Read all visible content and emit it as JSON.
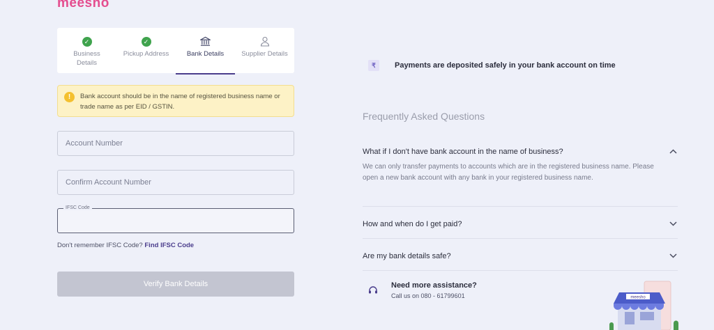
{
  "brand": {
    "logo": "meesho"
  },
  "stepper": {
    "steps": [
      {
        "label": "Business Details",
        "state": "done"
      },
      {
        "label": "Pickup Address",
        "state": "done"
      },
      {
        "label": "Bank Details",
        "state": "active"
      },
      {
        "label": "Supplier Details",
        "state": "pending"
      }
    ]
  },
  "notice": {
    "text": "Bank account should be in the name of registered business name or trade name as per EID / GSTIN."
  },
  "form": {
    "account_number_placeholder": "Account Number",
    "confirm_account_placeholder": "Confirm Account Number",
    "ifsc_label": "IFSC Code",
    "ifsc_value": "",
    "ifsc_help_text": "Don't remember IFSC Code?",
    "ifsc_help_link": "Find IFSC Code",
    "verify_button": "Verify Bank Details"
  },
  "info": {
    "safe_text": "Payments are deposited safely in your bank account on time"
  },
  "faq": {
    "title": "Frequently Asked Questions",
    "items": [
      {
        "question": "What if I don't have bank account in the name of business?",
        "answer": "We can only transfer payments to accounts which are in the registered business name. Please open a new bank account with any bank in your registered business name.",
        "expanded": true
      },
      {
        "question": "How and when do I get paid?",
        "answer": "",
        "expanded": false
      },
      {
        "question": "Are my bank details safe?",
        "answer": "",
        "expanded": false
      }
    ]
  },
  "assist": {
    "title": "Need more assistance?",
    "phone": "Call us on 080 - 61799601"
  },
  "illustration": {
    "store_sign": "meesho"
  },
  "colors": {
    "brand": "#e44e8f",
    "accent": "#4a3d8c",
    "success": "#3fa34d",
    "warning_bg": "#fdf2c6"
  }
}
